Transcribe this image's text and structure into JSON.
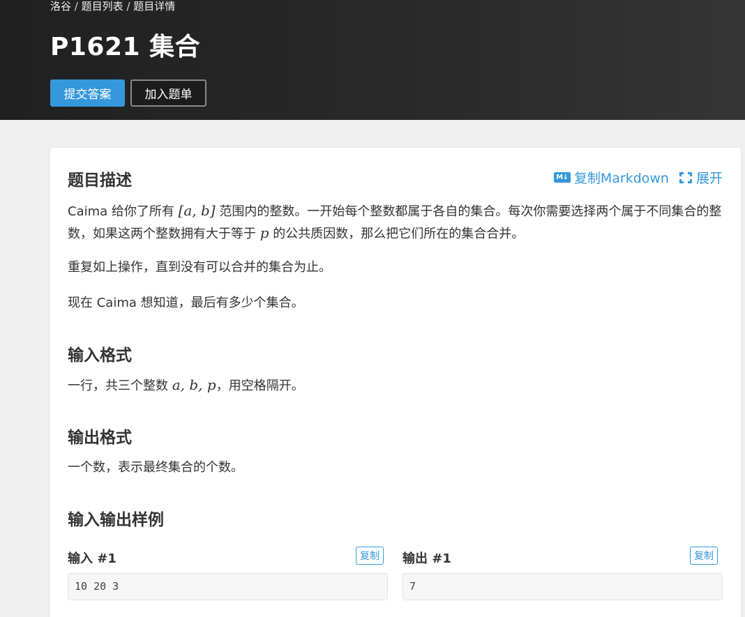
{
  "breadcrumb": {
    "items": [
      "洛谷",
      "题目列表",
      "题目详情"
    ],
    "separator": "/"
  },
  "problem": {
    "title": "P1621 集合"
  },
  "actions": {
    "submit_label": "提交答案",
    "add_label": "加入题单"
  },
  "tools": {
    "copy_markdown_label": "复制Markdown",
    "expand_label": "展开",
    "md_icon_text": "M↓",
    "icons": [
      "markdown-icon",
      "expand-icon"
    ]
  },
  "sections": {
    "description": {
      "heading": "题目描述",
      "p1_a": "Caima 给你了所有 ",
      "p1_math_range": "[a, b]",
      "p1_b": " 范围内的整数。一开始每个整数都属于各自的集合。每次你需要选择两个属于不同集合的整数，如果这两个整数拥有大于等于 ",
      "p1_math_p": "p",
      "p1_c": " 的公共质因数，那么把它们所在的集合合并。",
      "p2": "重复如上操作，直到没有可以合并的集合为止。",
      "p3": "现在 Caima 想知道，最后有多少个集合。"
    },
    "input_format": {
      "heading": "输入格式",
      "text_a": "一行，共三个整数 ",
      "text_math": "a, b, p",
      "text_b": "，用空格隔开。"
    },
    "output_format": {
      "heading": "输出格式",
      "text": "一个数，表示最终集合的个数。"
    },
    "samples": {
      "heading": "输入输出样例",
      "input_label": "输入 #1",
      "output_label": "输出 #1",
      "copy_label": "复制",
      "input_value": "10 20 3",
      "output_value": "7"
    }
  },
  "colors": {
    "accent": "#3498db",
    "header_bg": "#262626",
    "page_bg": "#efefef"
  }
}
